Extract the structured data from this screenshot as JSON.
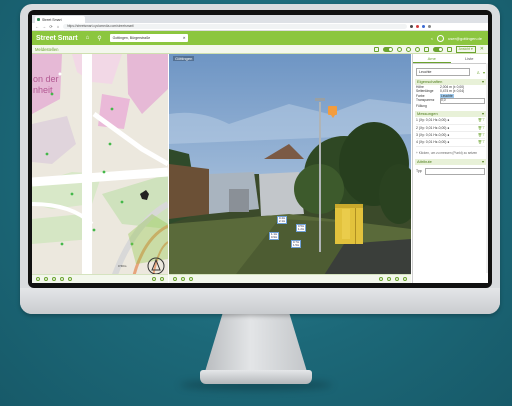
{
  "browser": {
    "tab_title": "Street Smart",
    "url": "https://streetsmart.cyclomedia.com/streetsmart/",
    "nav": [
      "←",
      "→",
      "⟳",
      "⌂"
    ]
  },
  "app": {
    "brand": "Street Smart",
    "search_value": "Gottingen, Bürgerstraße",
    "search_clear": "✕",
    "user_name": "user@gottingen.de",
    "share_icon": "<"
  },
  "toolbar": {
    "title": "Meldestellen",
    "select_label": "Ansicht ▾",
    "close": "✕"
  },
  "map": {
    "district_text_1": "on der",
    "district_text_2": "nheit",
    "scale_text": "0 50m"
  },
  "panorama": {
    "address": "Göttingen",
    "measure_boxes": [
      {
        "t1": "0.4m",
        "t2": "2.1m"
      },
      {
        "t1": "0.5m",
        "t2": "1.2m"
      },
      {
        "t1": "1.1m",
        "t2": "0.9m"
      },
      {
        "t1": "0.7m",
        "t2": "1.5m"
      }
    ]
  },
  "side": {
    "tabs": [
      "Ame",
      "Liste"
    ],
    "lamp_value": "Leuchte",
    "section_props": "Eigenschaften",
    "props": [
      {
        "k": "Höhe",
        "v": "2,004 m (± 0,00)"
      },
      {
        "k": "Seitenlänge",
        "v": "0,474 m (± 0,04)"
      },
      {
        "k": "Farbe",
        "v": "Leuchte"
      },
      {
        "k": "Transparenz",
        "v": "0,0"
      },
      {
        "k": "Füllung",
        "v": ""
      }
    ],
    "section_measure": "Messungen",
    "measurements": [
      "1 (Xy: 0,01 Hz-0,00) ●",
      "2 (Xy: 0,01 Hz-0,00) ●",
      "3 (Xy: 0,01 Hz-0,00) ●",
      "4 (Xy: 0,01 Hz-0,00) ●"
    ],
    "add_measure": "+ Klicken, um zu messen (Punkt) zu setzen",
    "section_attr": "Attribute",
    "attr_label": "Typ"
  }
}
